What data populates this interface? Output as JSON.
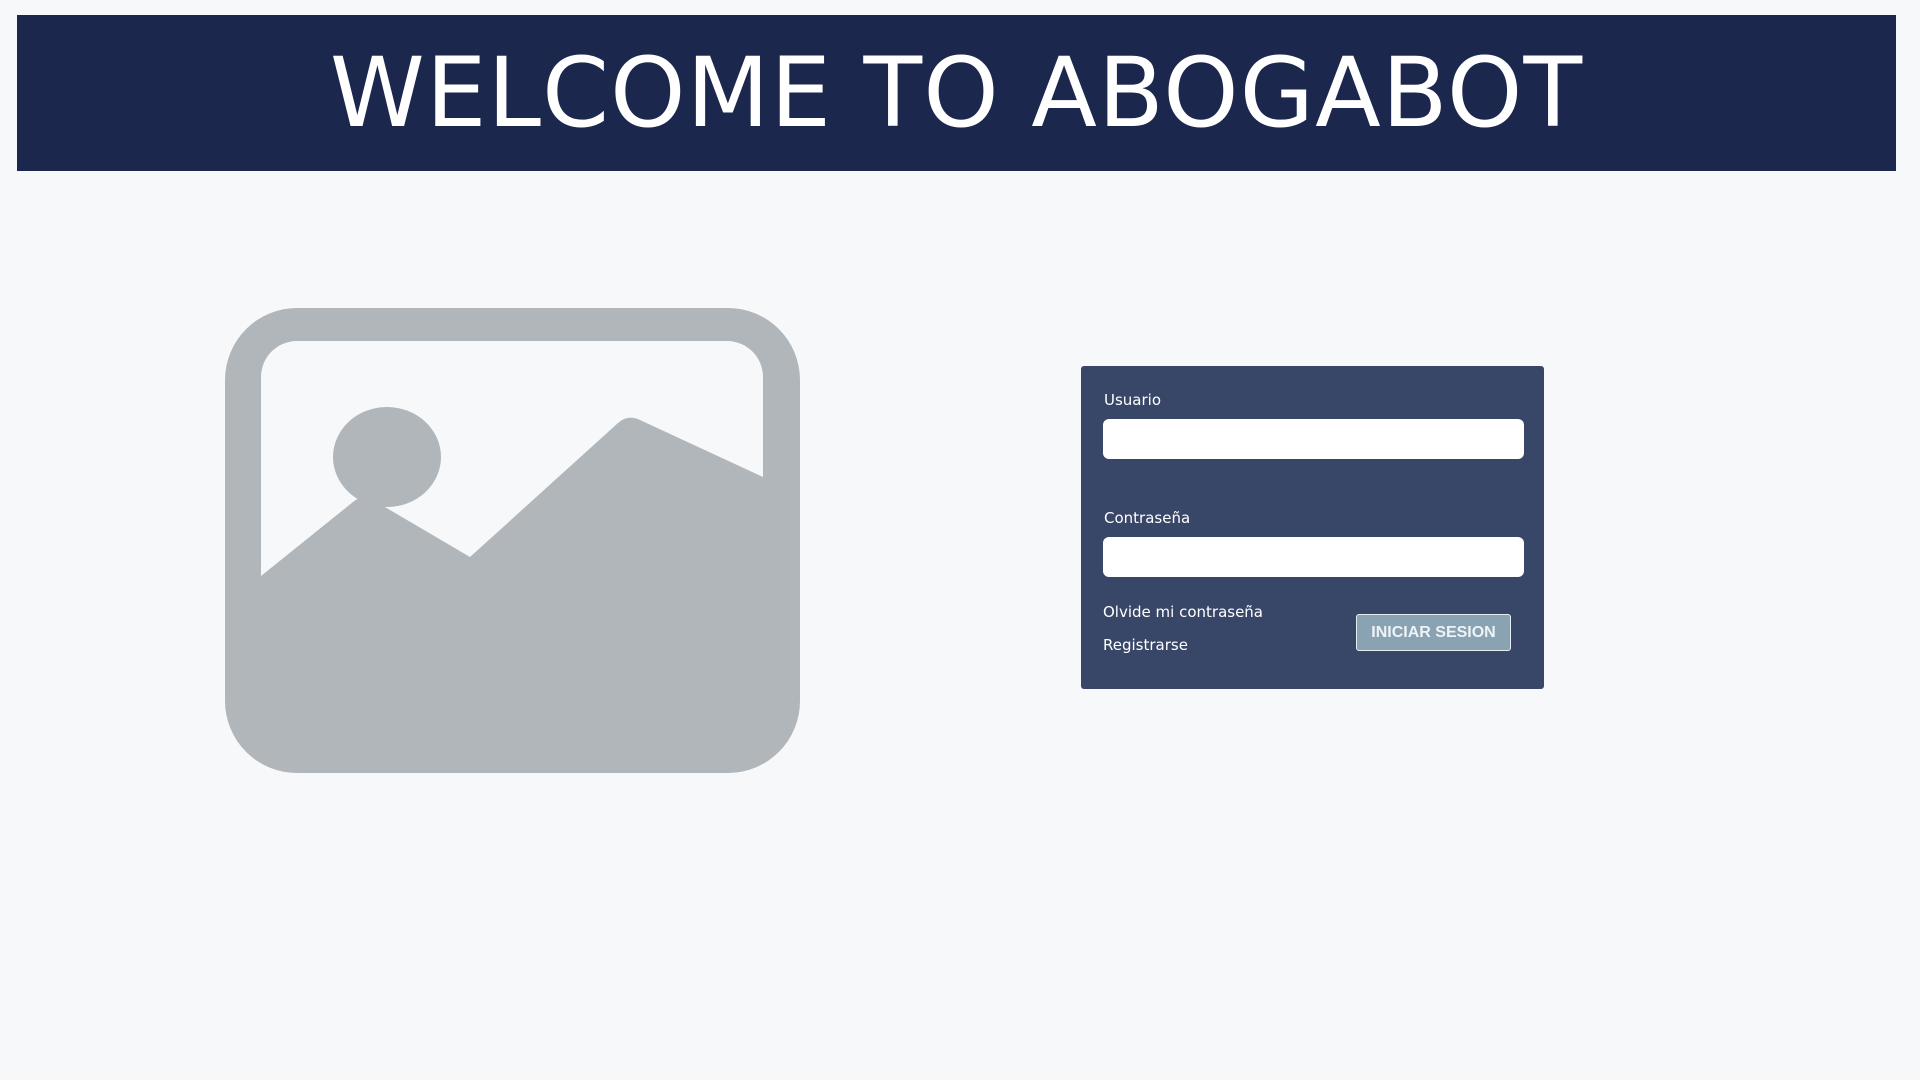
{
  "header": {
    "title": "WELCOME TO ABOGABOT"
  },
  "placeholder_image": {
    "icon": "image-placeholder-icon",
    "color": "#b1b6ba"
  },
  "login": {
    "username_label": "Usuario",
    "username_value": "",
    "password_label": "Contraseña",
    "password_value": "",
    "forgot_password_link": "Olvide mi contraseña",
    "register_link": "Registrarse",
    "submit_label": "INICIAR SESION"
  },
  "colors": {
    "header_bg": "#1b274d",
    "card_bg": "#384668",
    "button_bg": "#89a3b3",
    "page_bg": "#f7f8fa"
  }
}
